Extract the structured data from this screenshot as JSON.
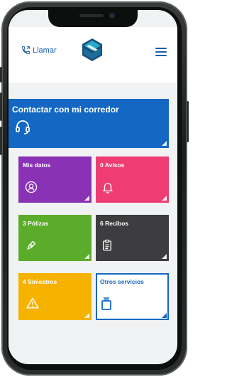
{
  "header": {
    "call_label": "Llamar"
  },
  "tiles": {
    "contact": {
      "label": "Contactar con mi corredor",
      "color": "#1468c4"
    },
    "mis_datos": {
      "label": "Mis datos",
      "color": "#8a32b5"
    },
    "avisos": {
      "label": "0 Avisos",
      "color": "#ef3d73"
    },
    "polizas": {
      "label": "3 Pólizas",
      "color": "#5cac2b"
    },
    "recibos": {
      "label": "6 Recibos",
      "color": "#3d3d3f"
    },
    "siniestros": {
      "label": "4 Siniestros",
      "color": "#f5b300"
    },
    "otros": {
      "label": "Otros servicios",
      "color": "#1468c4"
    }
  },
  "icons": [
    "phone-icon",
    "logo-icon",
    "menu-icon",
    "headset-icon",
    "user-icon",
    "bell-icon",
    "pen-icon",
    "receipt-icon",
    "warning-icon",
    "container-icon"
  ]
}
